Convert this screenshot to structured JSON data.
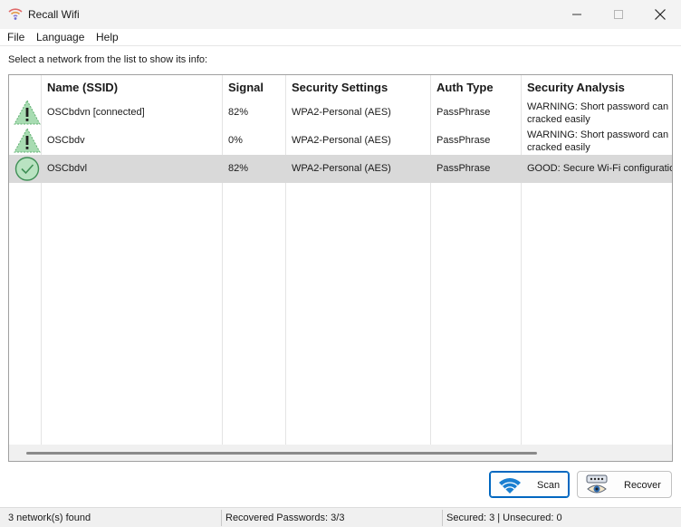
{
  "window": {
    "title": "Recall Wifi",
    "app_icon": "wifi-signal-icon",
    "controls": [
      "minimize-icon",
      "maximize-icon",
      "close-icon"
    ]
  },
  "menu": {
    "file": "File",
    "language": "Language",
    "help": "Help"
  },
  "instruction": "Select a network from the list to show its info:",
  "table": {
    "columns": [
      "Name (SSID)",
      "Signal",
      "Security Settings",
      "Auth Type",
      "Security Analysis"
    ],
    "rows": [
      {
        "icon": "warning-triangle-icon",
        "name": "OSCbdvn [connected]",
        "signal": "82%",
        "security": "WPA2-Personal (AES)",
        "auth": "PassPhrase",
        "analysis_line1": "WARNING: Short password can",
        "analysis_line2": "cracked easily",
        "selected": false
      },
      {
        "icon": "warning-triangle-icon",
        "name": "OSCbdv",
        "signal": "0%",
        "security": "WPA2-Personal (AES)",
        "auth": "PassPhrase",
        "analysis_line1": "WARNING: Short password can",
        "analysis_line2": "cracked easily",
        "selected": false
      },
      {
        "icon": "check-circle-icon",
        "name": "OSCbdvl",
        "signal": "82%",
        "security": "WPA2-Personal (AES)",
        "auth": "PassPhrase",
        "analysis_line1": "GOOD: Secure Wi-Fi configuratio",
        "analysis_line2": "",
        "selected": true
      }
    ]
  },
  "buttons": {
    "scan": {
      "label": "Scan",
      "icon": "wifi-scan-icon"
    },
    "recover": {
      "label": "Recover",
      "icon": "recover-eye-icon"
    }
  },
  "status": {
    "networks_found": "3 network(s) found",
    "recovered": "Recovered Passwords: 3/3",
    "secured": "Secured: 3 | Unsecured: 0"
  },
  "colors": {
    "accent": "#0067c0",
    "warning_icon": "#6abf7b",
    "selected_row": "#d9d9d9"
  }
}
